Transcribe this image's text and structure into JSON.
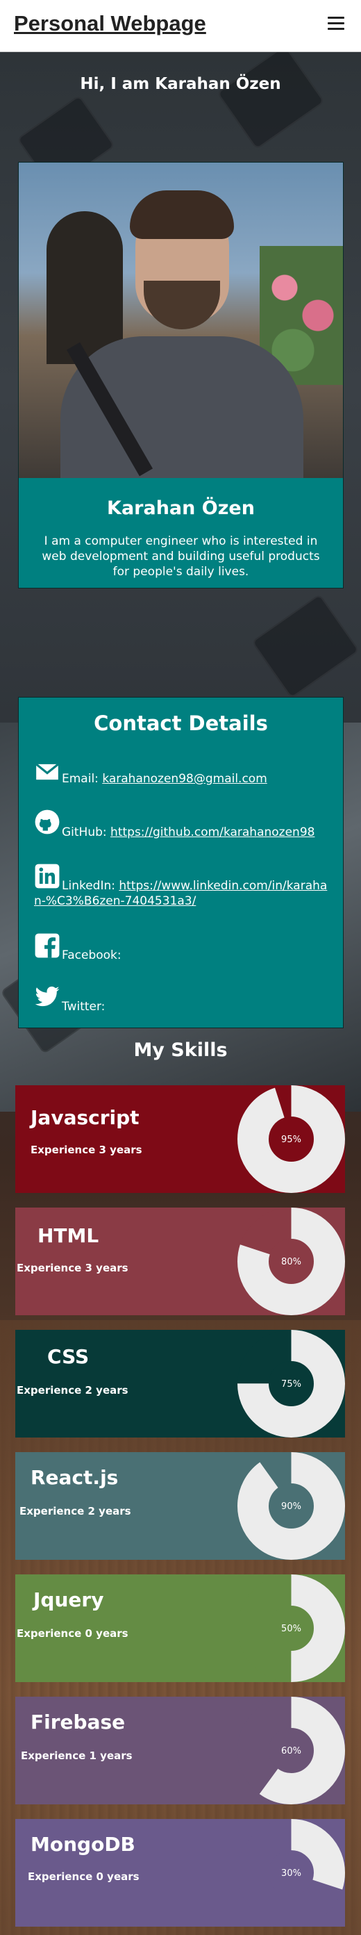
{
  "header": {
    "brand": "Personal Webpage",
    "menu_icon": "hamburger-icon"
  },
  "greeting": "Hi, I am Karahan Özen",
  "profile": {
    "name": "Karahan Özen",
    "bio": "I am a computer engineer who is interested in web development and building useful products for people's daily lives."
  },
  "contact": {
    "title": "Contact Details",
    "items": [
      {
        "icon": "envelope-icon",
        "label": "Email:",
        "link": "karahanozen98@gmail.com"
      },
      {
        "icon": "github-icon",
        "label": "GitHub:",
        "link": "https://github.com/karahanozen98"
      },
      {
        "icon": "linkedin-icon",
        "label": "LinkedIn:",
        "link": "https://www.linkedin.com/in/karahan-%C3%B6zen-7404531a3/"
      },
      {
        "icon": "facebook-icon",
        "label": "Facebook:",
        "link": ""
      },
      {
        "icon": "twitter-icon",
        "label": "Twitter:",
        "link": ""
      }
    ]
  },
  "skills": {
    "title": "My Skills",
    "items": [
      {
        "name": "Javascript",
        "experience": "Experience 3 years",
        "percent_label": "95%",
        "percent": 95,
        "color": "#7e0a16"
      },
      {
        "name": "HTML",
        "experience": "Experience 3 years",
        "percent_label": "80%",
        "percent": 80,
        "color": "#8a3b45"
      },
      {
        "name": "CSS",
        "experience": "Experience 2 years",
        "percent_label": "75%",
        "percent": 75,
        "color": "#073a38"
      },
      {
        "name": "React.js",
        "experience": "Experience 2 years",
        "percent_label": "90%",
        "percent": 90,
        "color": "#4a7074"
      },
      {
        "name": "Jquery",
        "experience": "Experience 0 years",
        "percent_label": "50%",
        "percent": 50,
        "color": "#648c44"
      },
      {
        "name": "Firebase",
        "experience": "Experience 1 years",
        "percent_label": "60%",
        "percent": 60,
        "color": "#6b5476"
      },
      {
        "name": "MongoDB",
        "experience": "Experience 0 years",
        "percent_label": "30%",
        "percent": 30,
        "color": "#6a5a8c"
      }
    ]
  }
}
